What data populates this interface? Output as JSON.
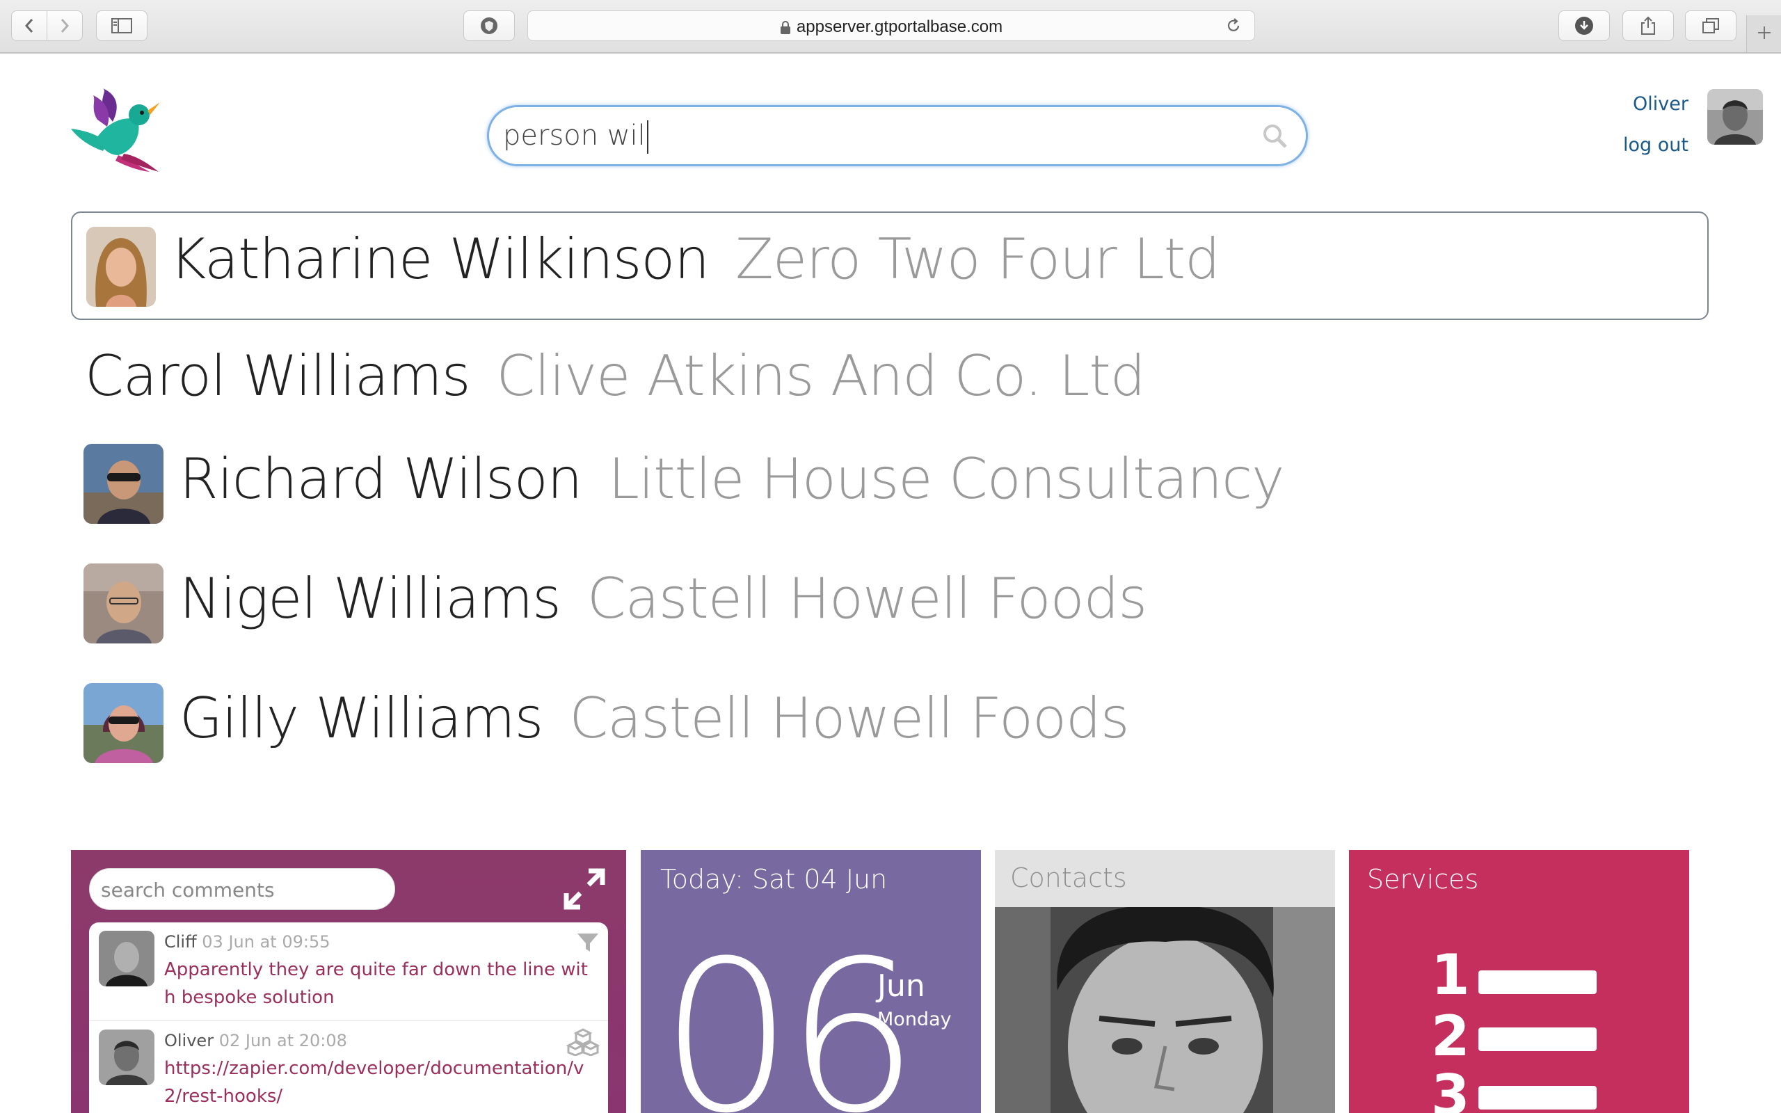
{
  "browser": {
    "url": "appserver.gtportalbase.com"
  },
  "header": {
    "search_value": "person wil",
    "user_name": "Oliver",
    "logout_label": "log out"
  },
  "results": [
    {
      "name": "Katharine Wilkinson",
      "company": "Zero Two Four Ltd",
      "has_avatar": true
    },
    {
      "name": "Carol Williams",
      "company": "Clive Atkins And Co. Ltd",
      "has_avatar": false
    },
    {
      "name": "Richard Wilson",
      "company": "Little House Consultancy",
      "has_avatar": true
    },
    {
      "name": "Nigel Williams",
      "company": "Castell Howell Foods",
      "has_avatar": true
    },
    {
      "name": "Gilly Williams",
      "company": "Castell Howell Foods",
      "has_avatar": true
    }
  ],
  "widgets": {
    "comments": {
      "search_placeholder": "search comments",
      "items": [
        {
          "author": "Cliff",
          "time": "03 Jun at 09:55",
          "text": "Apparently they are quite far down the line with bespoke solution",
          "icon": "filter-icon"
        },
        {
          "author": "Oliver",
          "time": "02 Jun at 20:08",
          "text": "https://zapier.com/developer/documentation/v2/rest-hooks/",
          "icon": "cubes-icon"
        }
      ]
    },
    "today": {
      "title": "Today: Sat 04 Jun",
      "day": "06",
      "month": "Jun",
      "weekday": "Monday"
    },
    "contacts": {
      "title": "Contacts"
    },
    "services": {
      "title": "Services",
      "icon": "numbered-list-icon"
    }
  },
  "colors": {
    "comments_bg": "#8c3a6a",
    "today_bg": "#786aa0",
    "services_bg": "#c42f5e",
    "link_blue": "#1a5a8a",
    "search_focus": "#7fb2e4"
  }
}
